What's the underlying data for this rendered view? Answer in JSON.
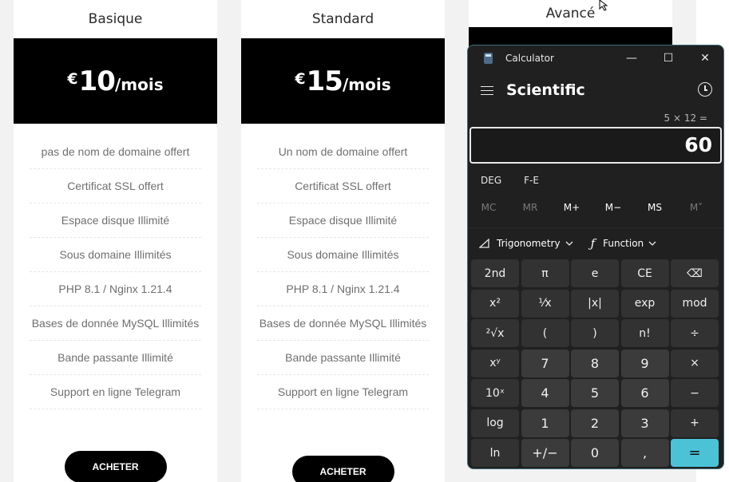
{
  "plans": [
    {
      "title": "Basique",
      "currency": "€",
      "amount": "10",
      "period": "/mois",
      "features": [
        "pas de nom de domaine offert",
        "Certificat SSL offert",
        "Espace disque Illimité",
        "Sous domaine Illimités",
        "PHP 8.1 / Nginx 1.21.4",
        "Bases de donnée MySQL Illimités",
        "Bande passante Illimité",
        "Support en ligne Telegram"
      ],
      "button": "ACHETER"
    },
    {
      "title": "Standard",
      "currency": "€",
      "amount": "15",
      "period": "/mois",
      "features": [
        "Un nom de domaine offert",
        "Certificat SSL offert",
        "Espace disque Illimité",
        "Sous domaine Illimités",
        "PHP 8.1 / Nginx 1.21.4",
        "Bases de donnée MySQL Illimités",
        "Bande passante Illimité",
        "Support en ligne Telegram"
      ],
      "button": "ACHETER"
    },
    {
      "title": "Avancé"
    }
  ],
  "calculator": {
    "app_title": "Calculator",
    "mode": "Scientific",
    "expression": "5 × 12 =",
    "display": "60",
    "angle_unit": "DEG",
    "notation": "F-E",
    "memory": [
      "MC",
      "MR",
      "M+",
      "M−",
      "MS",
      "M˅"
    ],
    "trigonometry_label": "Trigonometry",
    "function_label": "Function",
    "keys": [
      "2nd",
      "π",
      "e",
      "CE",
      "⌫",
      "x²",
      "¹⁄x",
      "|x|",
      "exp",
      "mod",
      "²√x",
      "(",
      ")",
      "n!",
      "÷",
      "xʸ",
      "7",
      "8",
      "9",
      "×",
      "10ˣ",
      "4",
      "5",
      "6",
      "−",
      "log",
      "1",
      "2",
      "3",
      "+",
      "ln",
      "+/−",
      "0",
      ",",
      "="
    ]
  }
}
